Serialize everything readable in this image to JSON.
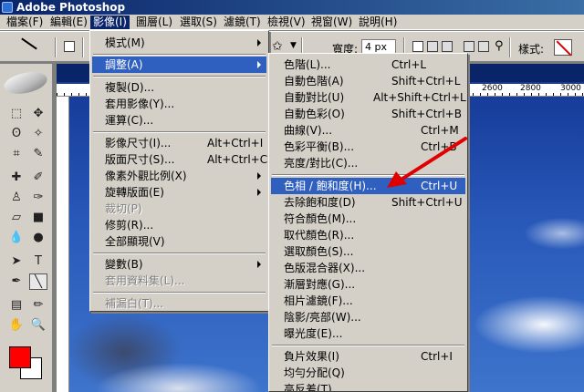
{
  "window": {
    "title": "Adobe Photoshop"
  },
  "menubar": [
    {
      "label": "檔案(F)"
    },
    {
      "label": "編輯(E)"
    },
    {
      "label": "影像(I)"
    },
    {
      "label": "圖層(L)"
    },
    {
      "label": "選取(S)"
    },
    {
      "label": "濾鏡(T)"
    },
    {
      "label": "檢視(V)"
    },
    {
      "label": "視窗(W)"
    },
    {
      "label": "說明(H)"
    }
  ],
  "options_bar": {
    "width_label": "寬度:",
    "width_value": "4 px",
    "style_label": "樣式:"
  },
  "document": {
    "ruler_ticks": [
      "2600",
      "2800",
      "3000"
    ]
  },
  "image_menu": [
    {
      "label": "模式(M)",
      "submenu": true
    },
    {
      "label": "調整(A)",
      "submenu": true,
      "highlighted": true
    },
    {
      "label": "複製(D)..."
    },
    {
      "label": "套用影像(Y)..."
    },
    {
      "label": "運算(C)..."
    },
    {
      "label": "影像尺寸(I)...",
      "shortcut": "Alt+Ctrl+I"
    },
    {
      "label": "版面尺寸(S)...",
      "shortcut": "Alt+Ctrl+C"
    },
    {
      "label": "像素外觀比例(X)",
      "submenu": true
    },
    {
      "label": "旋轉版面(E)",
      "submenu": true
    },
    {
      "label": "裁切(P)",
      "disabled": true
    },
    {
      "label": "修剪(R)..."
    },
    {
      "label": "全部顯現(V)"
    },
    {
      "label": "變數(B)",
      "submenu": true
    },
    {
      "label": "套用資料集(L)...",
      "disabled": true
    },
    {
      "label": "補漏白(T)...",
      "disabled": true
    }
  ],
  "adjust_menu": [
    {
      "label": "色階(L)...",
      "shortcut": "Ctrl+L"
    },
    {
      "label": "自動色階(A)",
      "shortcut": "Shift+Ctrl+L"
    },
    {
      "label": "自動對比(U)",
      "shortcut": "Alt+Shift+Ctrl+L"
    },
    {
      "label": "自動色彩(O)",
      "shortcut": "Shift+Ctrl+B"
    },
    {
      "label": "曲線(V)...",
      "shortcut": "Ctrl+M"
    },
    {
      "label": "色彩平衡(B)...",
      "shortcut": "Ctrl+B"
    },
    {
      "label": "亮度/對比(C)..."
    },
    {
      "label": "色相 / 飽和度(H)...",
      "shortcut": "Ctrl+U",
      "highlighted": true
    },
    {
      "label": "去除飽和度(D)",
      "shortcut": "Shift+Ctrl+U"
    },
    {
      "label": "符合顏色(M)..."
    },
    {
      "label": "取代顏色(R)..."
    },
    {
      "label": "選取顏色(S)..."
    },
    {
      "label": "色版混合器(X)..."
    },
    {
      "label": "漸層對應(G)..."
    },
    {
      "label": "相片濾鏡(F)..."
    },
    {
      "label": "陰影/亮部(W)..."
    },
    {
      "label": "曝光度(E)..."
    },
    {
      "label": "負片效果(I)",
      "shortcut": "Ctrl+I"
    },
    {
      "label": "均勻分配(Q)"
    },
    {
      "label": "高反差(T)..."
    }
  ],
  "colors": {
    "foreground": "#ff0000",
    "background": "#ffffff",
    "highlight": "#2f5fbf",
    "annotation_arrow": "#e00000"
  }
}
